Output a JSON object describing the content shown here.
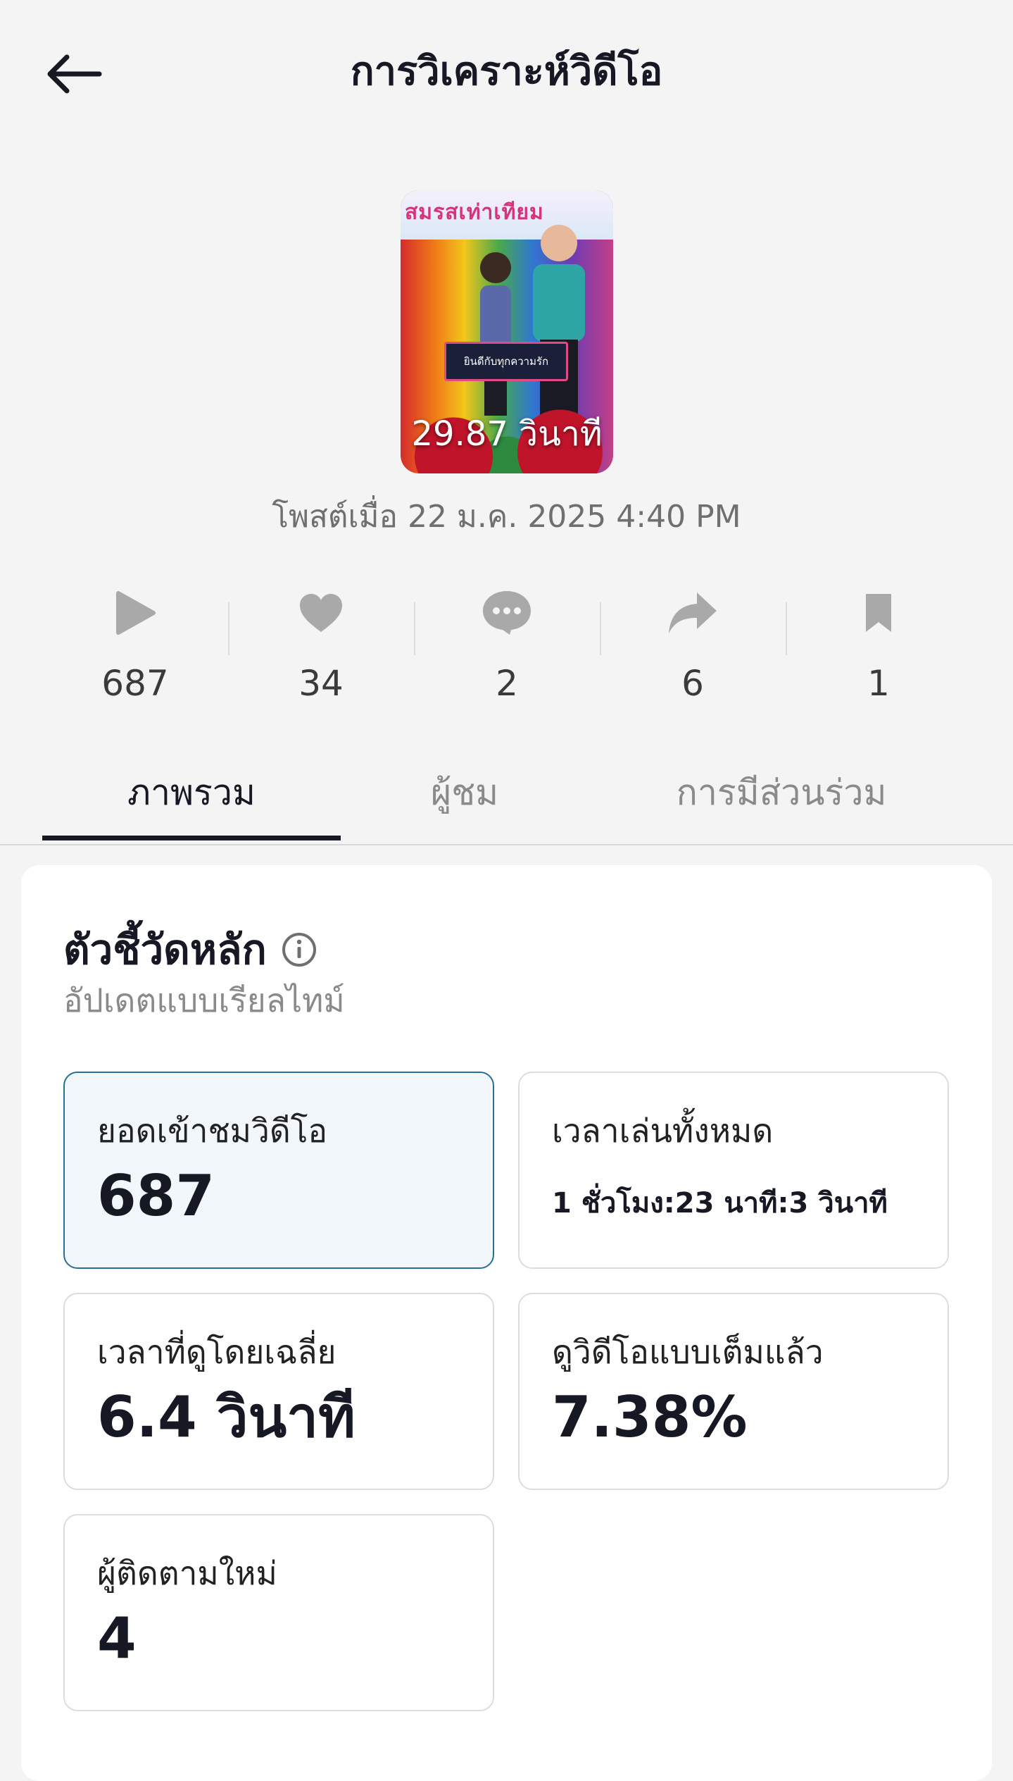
{
  "header": {
    "title": "การวิเคราะห์วิดีโอ",
    "back_icon": "arrow-left-icon"
  },
  "video": {
    "duration": "29.87 วินาที",
    "posted": "โพสต์เมื่อ 22 ม.ค. 2025 4:40 PM",
    "thumb_banner": "สมรสเท่าเทียม",
    "thumb_caption": "ยินดีกับทุกความรัก"
  },
  "stats": [
    {
      "icon": "play-icon",
      "value": "687"
    },
    {
      "icon": "heart-icon",
      "value": "34"
    },
    {
      "icon": "comment-icon",
      "value": "2"
    },
    {
      "icon": "share-icon",
      "value": "6"
    },
    {
      "icon": "bookmark-icon",
      "value": "1"
    }
  ],
  "tabs": [
    {
      "label": "ภาพรวม",
      "active": true
    },
    {
      "label": "ผู้ชม",
      "active": false
    },
    {
      "label": "การมีส่วนร่วม",
      "active": false
    }
  ],
  "key_metrics": {
    "title": "ตัวชี้วัดหลัก",
    "subtitle": "อัปเดตแบบเรียลไทม์",
    "items": [
      {
        "label": "ยอดเข้าชมวิดีโอ",
        "value": "687",
        "selected": true
      },
      {
        "label": "เวลาเล่นทั้งหมด",
        "value": "1 ชั่วโมง:23 นาที:3 วินาที",
        "selected": false
      },
      {
        "label": "เวลาที่ดูโดยเฉลี่ย",
        "value": "6.4 วินาที",
        "selected": false
      },
      {
        "label": "ดูวิดีโอแบบเต็มแล้ว",
        "value": "7.38%",
        "selected": false
      },
      {
        "label": "ผู้ติดตามใหม่",
        "value": "4",
        "selected": false
      }
    ]
  },
  "colors": {
    "selected_border": "#2a6e97",
    "selected_bg": "#f2f7fc",
    "icon_gray": "#a9a9a9"
  }
}
